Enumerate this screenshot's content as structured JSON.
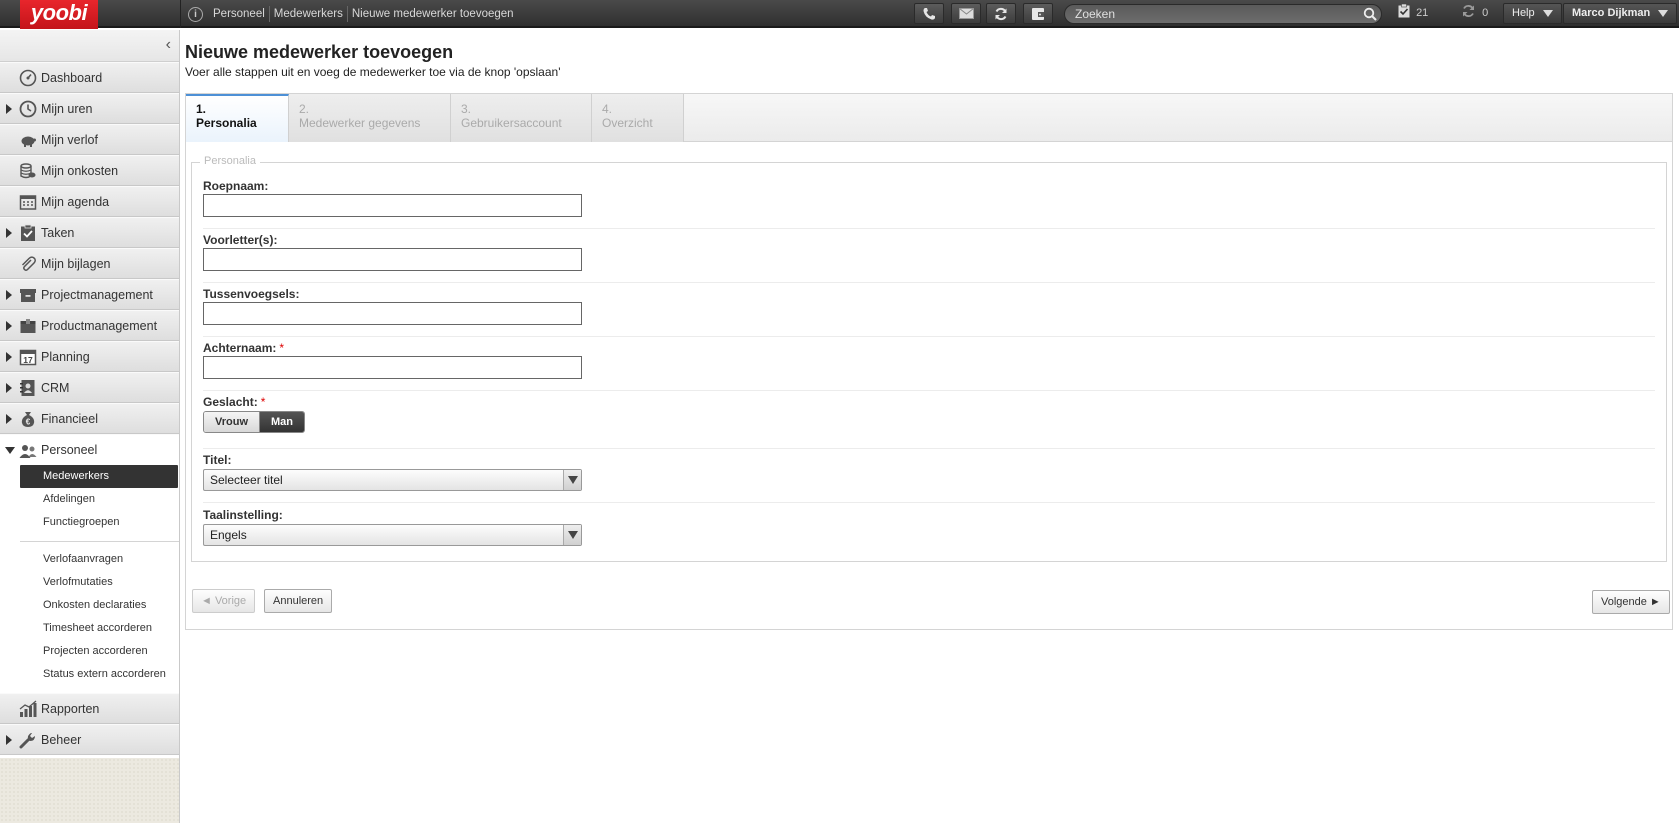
{
  "app": {
    "logo": "yoobi"
  },
  "breadcrumb": [
    "Personeel",
    "Medewerkers",
    "Nieuwe medewerker toevoegen"
  ],
  "topbar": {
    "search_placeholder": "Zoeken",
    "tasks_count": "21",
    "sync_count": "0",
    "help_label": "Help",
    "user_name": "Marco Dijkman",
    "icons": [
      "phone-icon",
      "mail-icon",
      "refresh-icon",
      "expense-icon",
      "search-icon",
      "task-check-icon",
      "sync-icon"
    ]
  },
  "sidebar": {
    "items": [
      {
        "label": "Dashboard",
        "icon": "dashboard-icon",
        "arrow": false
      },
      {
        "label": "Mijn uren",
        "icon": "clock-icon",
        "arrow": true
      },
      {
        "label": "Mijn verlof",
        "icon": "piggy-bank-icon",
        "arrow": false
      },
      {
        "label": "Mijn onkosten",
        "icon": "coins-icon",
        "arrow": false
      },
      {
        "label": "Mijn agenda",
        "icon": "calendar-icon",
        "arrow": false
      },
      {
        "label": "Taken",
        "icon": "clipboard-check-icon",
        "arrow": true
      },
      {
        "label": "Mijn bijlagen",
        "icon": "paperclip-icon",
        "arrow": false
      },
      {
        "label": "Projectmanagement",
        "icon": "archive-box-icon",
        "arrow": true
      },
      {
        "label": "Productmanagement",
        "icon": "package-icon",
        "arrow": true
      },
      {
        "label": "Planning",
        "icon": "calendar-17-icon",
        "arrow": true
      },
      {
        "label": "CRM",
        "icon": "address-book-icon",
        "arrow": true
      },
      {
        "label": "Financieel",
        "icon": "money-bag-icon",
        "arrow": true
      },
      {
        "label": "Personeel",
        "icon": "people-icon",
        "arrow": true
      }
    ],
    "personeel_sub": [
      "Medewerkers",
      "Afdelingen",
      "Functiegroepen"
    ],
    "personeel_sub2": [
      "Verlofaanvragen",
      "Verlofmutaties",
      "Onkosten declaraties",
      "Timesheet accorderen",
      "Projecten accorderen",
      "Status extern accorderen"
    ],
    "bottom_items": [
      {
        "label": "Rapporten",
        "icon": "chart-bars-icon",
        "arrow": false
      },
      {
        "label": "Beheer",
        "icon": "wrench-icon",
        "arrow": true
      }
    ]
  },
  "main": {
    "title": "Nieuwe medewerker toevoegen",
    "subtitle": "Voer alle stappen uit en voeg de medewerker toe via de knop 'opslaan'",
    "steps": [
      {
        "num": "1.",
        "label": "Personalia"
      },
      {
        "num": "2.",
        "label": "Medewerker gegevens"
      },
      {
        "num": "3.",
        "label": "Gebruikersaccount"
      },
      {
        "num": "4.",
        "label": "Overzicht"
      }
    ],
    "fieldset_legend": "Personalia",
    "fields": {
      "roepnaam": {
        "label": "Roepnaam:",
        "value": ""
      },
      "voorletters": {
        "label": "Voorletter(s):",
        "value": ""
      },
      "tussenvoegsels": {
        "label": "Tussenvoegsels:",
        "value": ""
      },
      "achternaam": {
        "label": "Achternaam:",
        "value": "",
        "required": "*"
      },
      "geslacht": {
        "label": "Geslacht:",
        "required": "*",
        "options": [
          "Vrouw",
          "Man"
        ],
        "selected": "Man"
      },
      "titel": {
        "label": "Titel:",
        "value": "Selecteer titel"
      },
      "taalinstelling": {
        "label": "Taalinstelling:",
        "value": "Engels"
      }
    },
    "buttons": {
      "prev": "◄ Vorige",
      "cancel": "Annuleren",
      "next": "Volgende ►"
    }
  },
  "colors": {
    "brand_red": "#d81e25",
    "active_step": "#4d90d6",
    "required": "#dd0000"
  }
}
